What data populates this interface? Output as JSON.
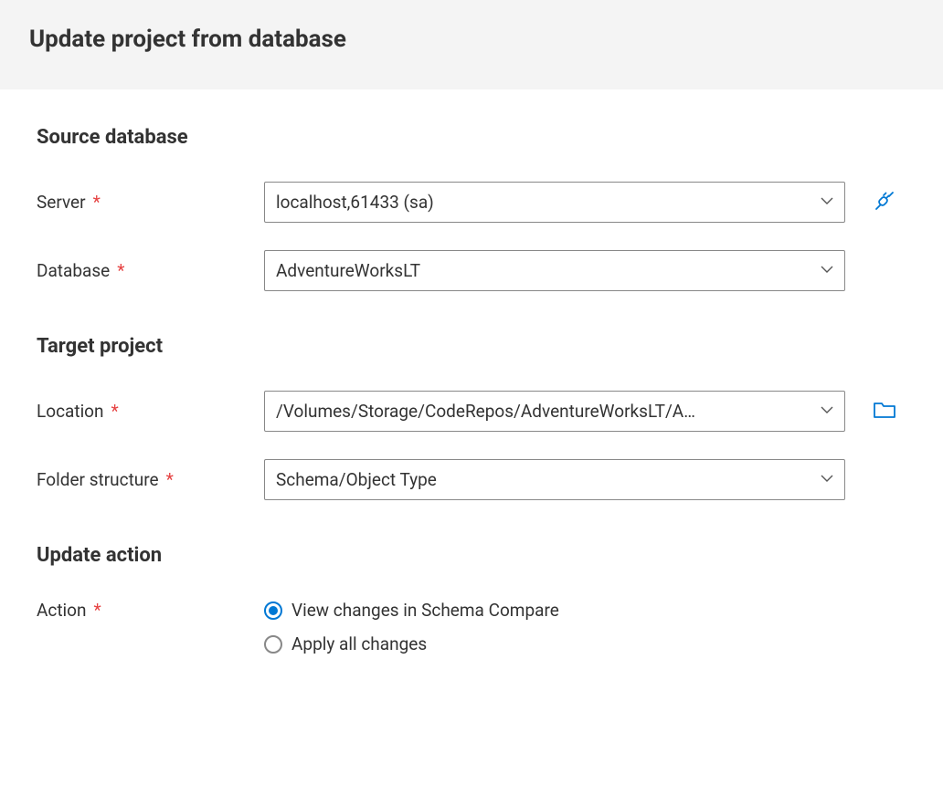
{
  "header": {
    "title": "Update project from database"
  },
  "source": {
    "heading": "Source database",
    "server_label": "Server",
    "server_value": "localhost,61433 (sa)",
    "database_label": "Database",
    "database_value": "AdventureWorksLT"
  },
  "target": {
    "heading": "Target project",
    "location_label": "Location",
    "location_value": "/Volumes/Storage/CodeRepos/AdventureWorksLT/A…",
    "folder_label": "Folder structure",
    "folder_value": "Schema/Object Type"
  },
  "action": {
    "heading": "Update action",
    "label": "Action",
    "option_view": "View changes in Schema Compare",
    "option_apply": "Apply all changes",
    "selected": "view"
  },
  "colors": {
    "accent": "#0078d4",
    "required": "#e64343"
  }
}
